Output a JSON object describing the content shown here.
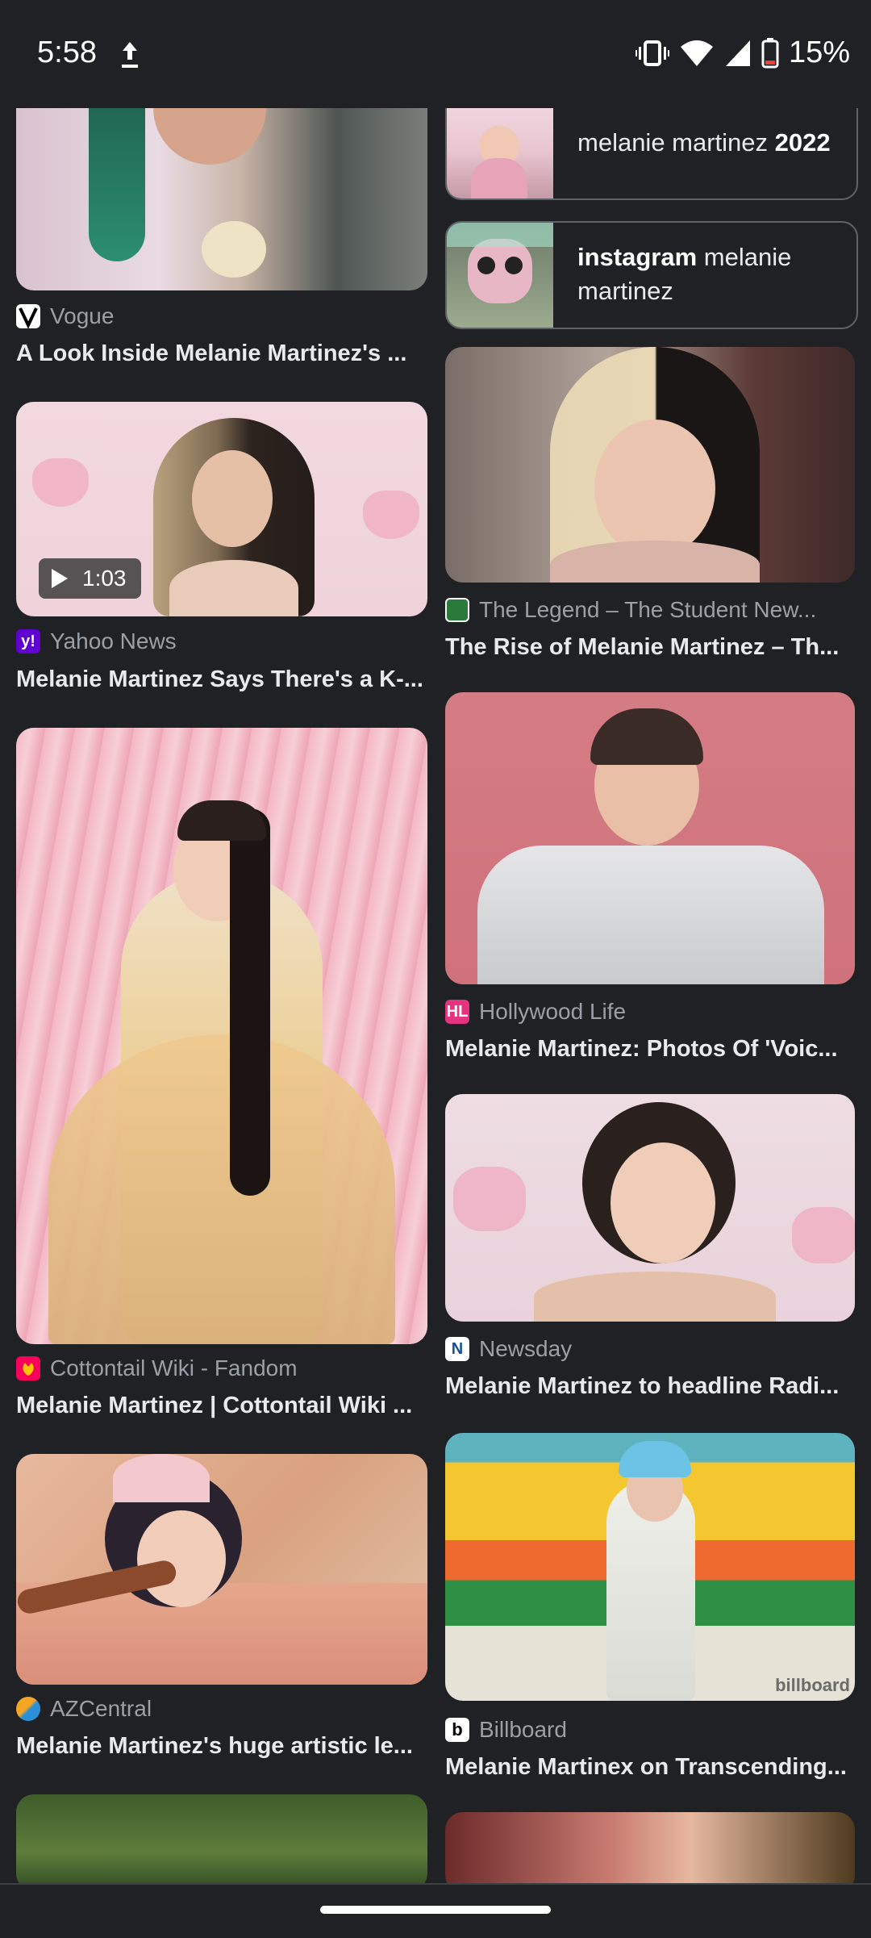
{
  "status_bar": {
    "time": "5:58",
    "battery": "15%"
  },
  "chips": [
    {
      "text_plain": "melanie martinez ",
      "text_bold": "2022"
    },
    {
      "text_bold": "instagram",
      "text_plain": " melanie martinez"
    }
  ],
  "left_column": [
    {
      "source": "Vogue",
      "title": "A Look Inside Melanie Martinez's ..."
    },
    {
      "source": "Yahoo News",
      "title": "Melanie Martinez Says There's a K-...",
      "duration": "1:03"
    },
    {
      "source": "Cottontail Wiki - Fandom",
      "title": "Melanie Martinez | Cottontail Wiki ..."
    },
    {
      "source": "AZCentral",
      "title": "Melanie Martinez's huge artistic le..."
    }
  ],
  "right_column": [
    {
      "source": "The Legend – The Student New...",
      "title": "The Rise of Melanie Martinez – Th..."
    },
    {
      "source": "Hollywood Life",
      "title": "Melanie Martinez: Photos Of 'Voic..."
    },
    {
      "source": "Newsday",
      "title": "Melanie Martinez to headline Radi..."
    },
    {
      "source": "Billboard",
      "title": "Melanie Martinex on Transcending..."
    }
  ],
  "watermark": "billboard",
  "colors": {
    "background": "#202124",
    "text": "#e8eaed",
    "secondary_text": "#9aa0a6",
    "yahoo": "#6001d2"
  }
}
